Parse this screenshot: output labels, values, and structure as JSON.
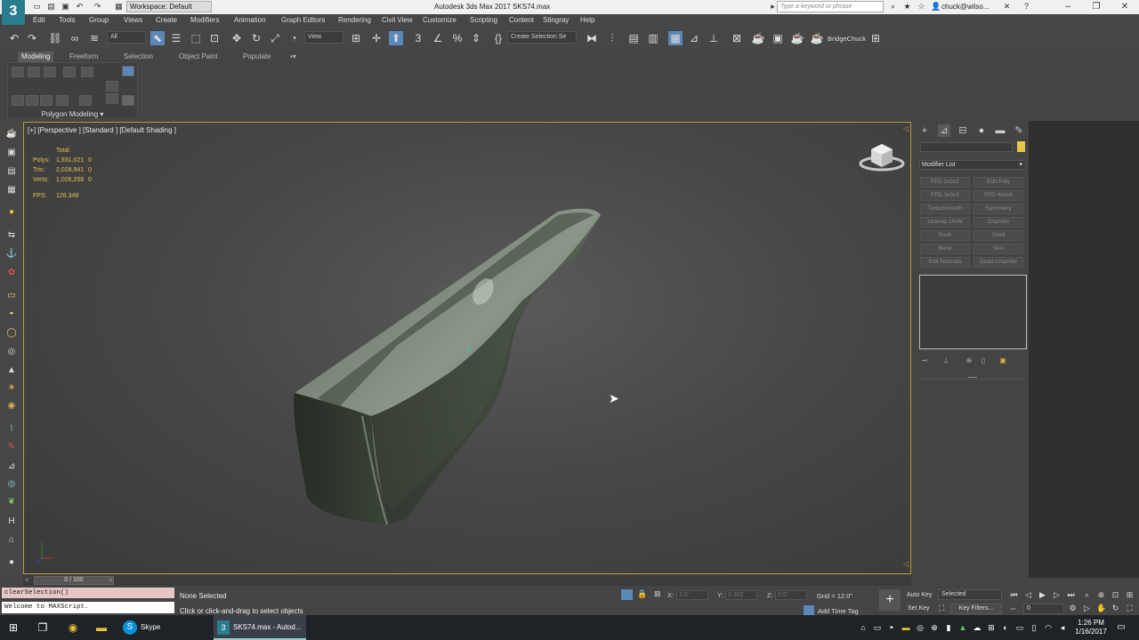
{
  "titlebar": {
    "logo": "3",
    "workspace": "Workspace: Default",
    "title": "Autodesk 3ds Max 2017      SKS74.max",
    "search_placeholder": "Type a keyword or phrase",
    "user": "chuck@wilso..."
  },
  "menu": [
    "Edit",
    "Tools",
    "Group",
    "Views",
    "Create",
    "Modifiers",
    "Animation",
    "Graph Editors",
    "Rendering",
    "Civil View",
    "Customize",
    "Scripting",
    "Content",
    "Stingray",
    "Help"
  ],
  "toolbar": {
    "filter_dropdown": "All",
    "view_dropdown": "View",
    "selection_set": "Create Selection Se",
    "bridge_label": "BridgeChuck"
  },
  "ribbon": {
    "tabs": [
      "Modeling",
      "Freeform",
      "Selection",
      "Object Paint",
      "Populate"
    ],
    "panel_title": "Polygon Modeling ▾"
  },
  "viewport": {
    "label": "[+] [Perspective ] [Standard ] [Default Shading ]",
    "stats_header": "Total",
    "stats": [
      {
        "label": "Polys:",
        "total": "1,931,021",
        "sel": "0"
      },
      {
        "label": "Tris:",
        "total": "2,028,941",
        "sel": "0"
      },
      {
        "label": "Verts:",
        "total": "1,026,258",
        "sel": "0"
      }
    ],
    "fps_label": "FPS:",
    "fps_value": "126.349"
  },
  "command_panel": {
    "modifier_list": "Modifier List",
    "modifier_buttons": [
      "FFD 2x2x2",
      "Edit Poly",
      "FFD 3x3x3",
      "FFD 4x4x4",
      "TurboSmooth",
      "Symmetry",
      "Unwrap UVW",
      "Chamfer",
      "Push",
      "Shell",
      "Bend",
      "Skin",
      "Edit Normals",
      "Quad Chamfer"
    ]
  },
  "timeslider": {
    "frame": "0 / 100"
  },
  "status": {
    "listener_top": "clearSelection()",
    "listener_bottom": "Welcome to MAXScript.",
    "selection": "None Selected",
    "prompt": "Click or click-and-drag to select objects",
    "x_label": "X:",
    "x_value": "2.0'",
    "y_label": "Y:",
    "y_value": "2.302'",
    "z_label": "Z:",
    "z_value": "0.0'",
    "grid": "Grid = 12.0\"",
    "add_time_tag": "Add Time Tag",
    "auto_key": "Auto Key",
    "set_key": "Set Key",
    "selected_dropdown": "Selected",
    "key_filters": "Key Filters...",
    "frame_field": "0"
  },
  "taskbar": {
    "skype": "Skype",
    "max_app": "SKS74.max - Autod...",
    "time": "1:26 PM",
    "date": "1/16/2017"
  },
  "colors": {
    "viewport_border": "#b59a3b",
    "stats_text": "#e8c14a",
    "object_green": "#4e5a4c"
  }
}
